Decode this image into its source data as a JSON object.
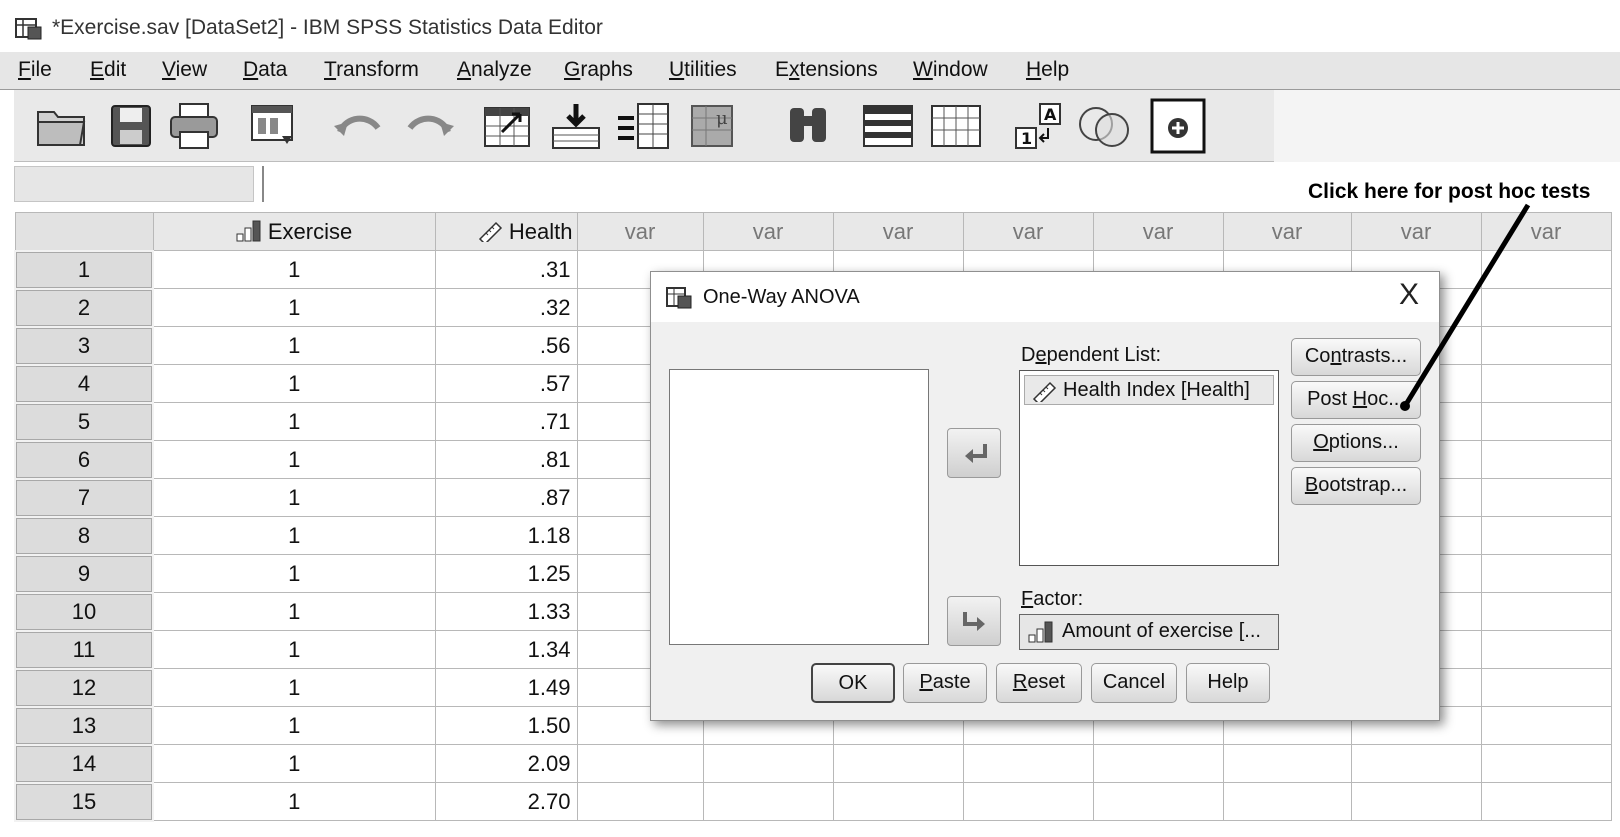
{
  "window": {
    "title": "*Exercise.sav [DataSet2] - IBM SPSS Statistics Data Editor"
  },
  "menu": [
    {
      "pre": "",
      "acc": "F",
      "post": "ile"
    },
    {
      "pre": "",
      "acc": "E",
      "post": "dit"
    },
    {
      "pre": "",
      "acc": "V",
      "post": "iew"
    },
    {
      "pre": "",
      "acc": "D",
      "post": "ata"
    },
    {
      "pre": "",
      "acc": "T",
      "post": "ransform"
    },
    {
      "pre": "",
      "acc": "A",
      "post": "nalyze"
    },
    {
      "pre": "",
      "acc": "G",
      "post": "raphs"
    },
    {
      "pre": "",
      "acc": "U",
      "post": "tilities"
    },
    {
      "pre": "E",
      "acc": "x",
      "post": "tensions"
    },
    {
      "pre": "",
      "acc": "W",
      "post": "indow"
    },
    {
      "pre": "",
      "acc": "H",
      "post": "elp"
    }
  ],
  "toolbar_icons": [
    "open-folder-icon",
    "save-icon",
    "print-icon",
    "dialog-recall-icon",
    "undo-icon",
    "redo-icon",
    "goto-case-icon",
    "goto-variable-icon",
    "variables-icon",
    "run-descriptives-icon",
    "find-icon",
    "insert-cases-icon",
    "insert-variable-icon",
    "split-file-icon",
    "value-labels-icon",
    "use-sets-icon",
    "spelling-icon"
  ],
  "annotation": "Click here for post hoc tests",
  "grid": {
    "columns": [
      "Exercise",
      "Health",
      "var",
      "var",
      "var",
      "var",
      "var",
      "var",
      "var",
      "var"
    ],
    "rows": [
      {
        "n": "1",
        "exercise": "1",
        "health": ".31"
      },
      {
        "n": "2",
        "exercise": "1",
        "health": ".32"
      },
      {
        "n": "3",
        "exercise": "1",
        "health": ".56"
      },
      {
        "n": "4",
        "exercise": "1",
        "health": ".57"
      },
      {
        "n": "5",
        "exercise": "1",
        "health": ".71"
      },
      {
        "n": "6",
        "exercise": "1",
        "health": ".81"
      },
      {
        "n": "7",
        "exercise": "1",
        "health": ".87"
      },
      {
        "n": "8",
        "exercise": "1",
        "health": "1.18"
      },
      {
        "n": "9",
        "exercise": "1",
        "health": "1.25"
      },
      {
        "n": "10",
        "exercise": "1",
        "health": "1.33"
      },
      {
        "n": "11",
        "exercise": "1",
        "health": "1.34"
      },
      {
        "n": "12",
        "exercise": "1",
        "health": "1.49"
      },
      {
        "n": "13",
        "exercise": "1",
        "health": "1.50"
      },
      {
        "n": "14",
        "exercise": "1",
        "health": "2.09"
      },
      {
        "n": "15",
        "exercise": "1",
        "health": "2.70"
      }
    ]
  },
  "dialog": {
    "title": "One-Way ANOVA",
    "close": "X",
    "dependent_label": {
      "pre": "D",
      "acc": "e",
      "post": "pendent List:"
    },
    "dependent_items": [
      "Health Index [Health]"
    ],
    "factor_label": {
      "pre": "",
      "acc": "F",
      "post": "actor:"
    },
    "factor_value": "Amount of exercise [...",
    "side_buttons": [
      {
        "pre": "Co",
        "acc": "n",
        "post": "trasts..."
      },
      {
        "pre": "Post ",
        "acc": "H",
        "post": "oc..."
      },
      {
        "pre": "",
        "acc": "O",
        "post": "ptions..."
      },
      {
        "pre": "",
        "acc": "B",
        "post": "ootstrap..."
      }
    ],
    "bottom_buttons": [
      {
        "pre": "OK",
        "acc": "",
        "post": ""
      },
      {
        "pre": "",
        "acc": "P",
        "post": "aste"
      },
      {
        "pre": "",
        "acc": "R",
        "post": "eset"
      },
      {
        "pre": "Cancel",
        "acc": "",
        "post": ""
      },
      {
        "pre": "Help",
        "acc": "",
        "post": ""
      }
    ]
  }
}
